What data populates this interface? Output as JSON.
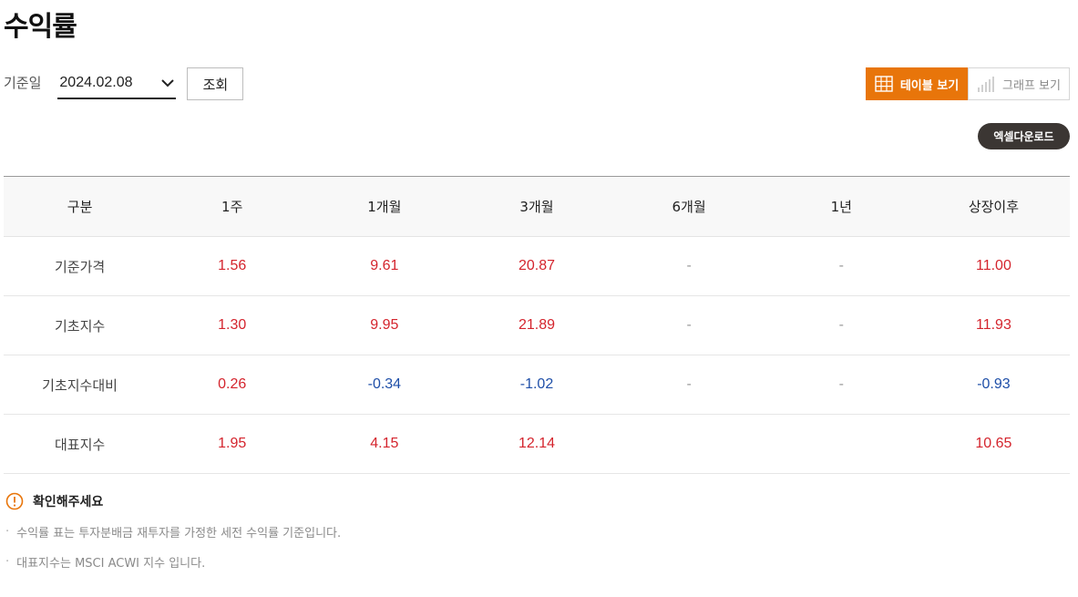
{
  "page": {
    "title": "수익률"
  },
  "filter": {
    "label": "기준일",
    "date_value": "2024.02.08",
    "search_label": "조회"
  },
  "view_toggle": {
    "table_label": "테이블 보기",
    "graph_label": "그래프 보기",
    "active": "table"
  },
  "excel": {
    "label": "엑셀다운로드"
  },
  "table": {
    "headers": [
      "구분",
      "1주",
      "1개월",
      "3개월",
      "6개월",
      "1년",
      "상장이후"
    ],
    "rows": [
      {
        "label": "기준가격",
        "cells": [
          "1.56",
          "9.61",
          "20.87",
          "-",
          "-",
          "11.00"
        ]
      },
      {
        "label": "기초지수",
        "cells": [
          "1.30",
          "9.95",
          "21.89",
          "-",
          "-",
          "11.93"
        ]
      },
      {
        "label": "기초지수대비",
        "cells": [
          "0.26",
          "-0.34",
          "-1.02",
          "-",
          "-",
          "-0.93"
        ]
      },
      {
        "label": "대표지수",
        "cells": [
          "1.95",
          "4.15",
          "12.14",
          "",
          "",
          "10.65"
        ]
      }
    ]
  },
  "notice": {
    "title": "확인해주세요",
    "items": [
      "수익률 표는 투자분배금 재투자를 가정한 세전 수익률 기준입니다.",
      "대표지수는 MSCI ACWI 지수 입니다."
    ]
  },
  "colors": {
    "accent": "#e8750a",
    "positive": "#d4242d",
    "negative": "#1f4fa8",
    "excel_bg": "#3b3633"
  }
}
